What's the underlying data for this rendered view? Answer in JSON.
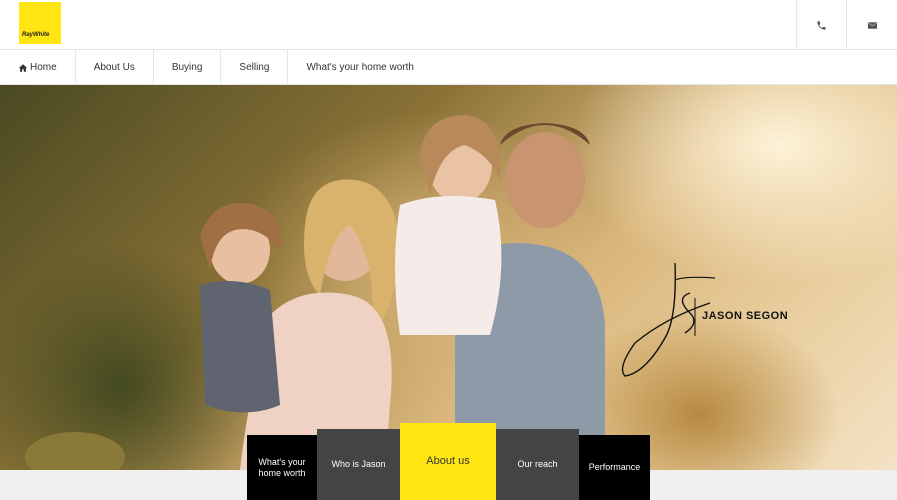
{
  "brand": {
    "logo_text": "RayWhite",
    "accent": "#ffe512"
  },
  "header": {
    "icons": [
      "phone-icon",
      "envelope-icon"
    ]
  },
  "nav": {
    "items": [
      {
        "label": "Home",
        "icon": "home-icon"
      },
      {
        "label": "About Us"
      },
      {
        "label": "Buying"
      },
      {
        "label": "Selling"
      },
      {
        "label": "What's your home worth"
      }
    ]
  },
  "hero": {
    "signature_name": "JASON SEGON",
    "signature_initials": "JS"
  },
  "tabs": [
    {
      "label": "What's your home worth",
      "style": "dark"
    },
    {
      "label": "Who is Jason",
      "style": "grey"
    },
    {
      "label": "About us",
      "style": "yellow"
    },
    {
      "label": "Our reach",
      "style": "grey"
    },
    {
      "label": "Performance",
      "style": "dark"
    }
  ]
}
